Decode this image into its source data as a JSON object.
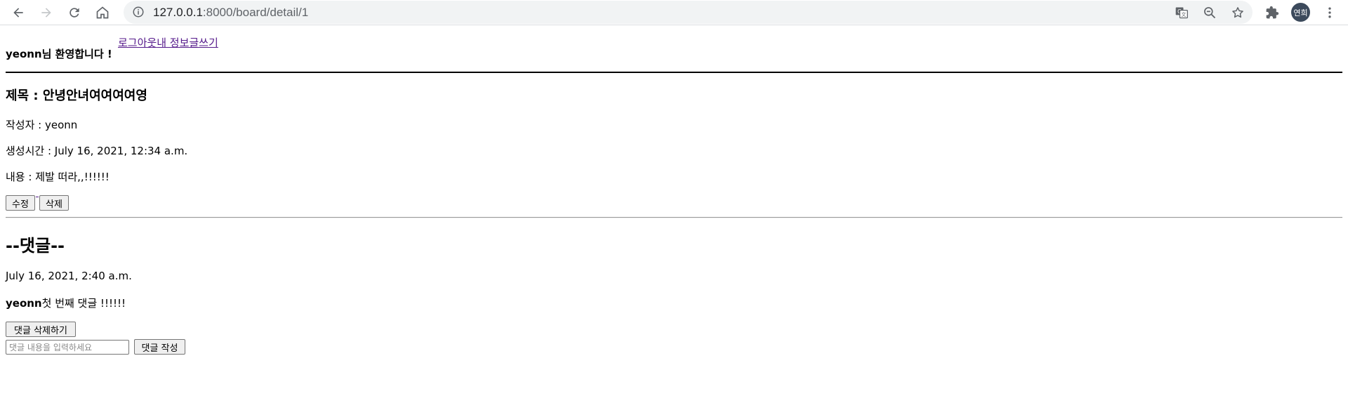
{
  "browser": {
    "url_host": "127.0.0.1",
    "url_rest": ":8000/board/detail/1",
    "profile_initials": "연희"
  },
  "header": {
    "links": [
      {
        "label": "로그아웃"
      },
      {
        "label": "내 정보"
      },
      {
        "label": "글쓰기"
      }
    ],
    "welcome_user": "yeonn",
    "welcome_suffix": "님 환영합니다 !"
  },
  "post": {
    "title": "제목 : 안녕안녀여여여여영",
    "author": "작성자 : yeonn",
    "created": "생성시간 : July 16, 2021, 12:34 a.m.",
    "body": "내용 : 제발 떠라,,!!!!!!",
    "edit_label": "수정",
    "delete_label": "삭제"
  },
  "comments": {
    "heading": "--댓글--",
    "items": [
      {
        "time": "July 16, 2021, 2:40 a.m.",
        "author": "yeonn",
        "text": "첫 번째 댓글 !!!!!!",
        "delete_label": "댓글 삭제하기"
      }
    ],
    "input_placeholder": "댓글 내용을 입력하세요",
    "submit_label": "댓글 작성"
  }
}
